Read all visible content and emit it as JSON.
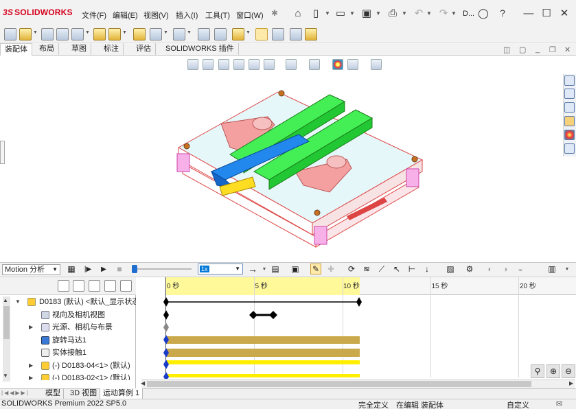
{
  "app": {
    "logo_ds": "3S",
    "logo_text": "SOLIDWORKS",
    "doc_title": "D..."
  },
  "menu": [
    "文件(F)",
    "编辑(E)",
    "视图(V)",
    "插入(I)",
    "工具(T)",
    "窗口(W)"
  ],
  "tabs": [
    "装配体",
    "布局",
    "草图",
    "标注",
    "评估",
    "SOLIDWORKS 插件"
  ],
  "active_tab": "装配体",
  "motion": {
    "study_type": "Motion 分析",
    "speed": "1x",
    "timeline_ticks": [
      "0 秒",
      "5 秒",
      "10 秒",
      "15 秒",
      "20 秒"
    ],
    "tick_values": [
      0,
      5,
      10,
      15,
      20
    ],
    "end_time_seconds": 10.5,
    "playhead_fraction": 0.0
  },
  "tree": [
    {
      "label": "D0183 (默认) <默认_显示状态",
      "icon": "assembly-icon",
      "expand": "▼"
    },
    {
      "label": "视向及相机视图",
      "icon": "camera-view-icon",
      "expand": ""
    },
    {
      "label": "光源、相机与布景",
      "icon": "lights-icon",
      "expand": "▶"
    },
    {
      "label": "旋转马达1",
      "icon": "rotary-motor-icon",
      "expand": ""
    },
    {
      "label": "实体接触1",
      "icon": "contact-icon",
      "expand": ""
    },
    {
      "label": "(-) D0183-04<1> (默认)",
      "icon": "part-icon",
      "expand": "▶"
    },
    {
      "label": "(-) D0183-02<1> (默认)",
      "icon": "part-icon",
      "expand": "▶"
    }
  ],
  "bottom_tabs": [
    "模型",
    "3D 视图",
    "运动算例 1"
  ],
  "active_bottom_tab": "运动算例 1",
  "status": {
    "version": "SOLIDWORKS Premium 2022 SP5.0",
    "definition": "完全定义",
    "editing": "在编辑 装配体",
    "units": "自定义"
  },
  "colors": {
    "keyframe_yellow": "#fff99a",
    "motor_bar": "#c9a94b",
    "part_bar": "#ffee00",
    "accent_blue": "#0078d7"
  }
}
